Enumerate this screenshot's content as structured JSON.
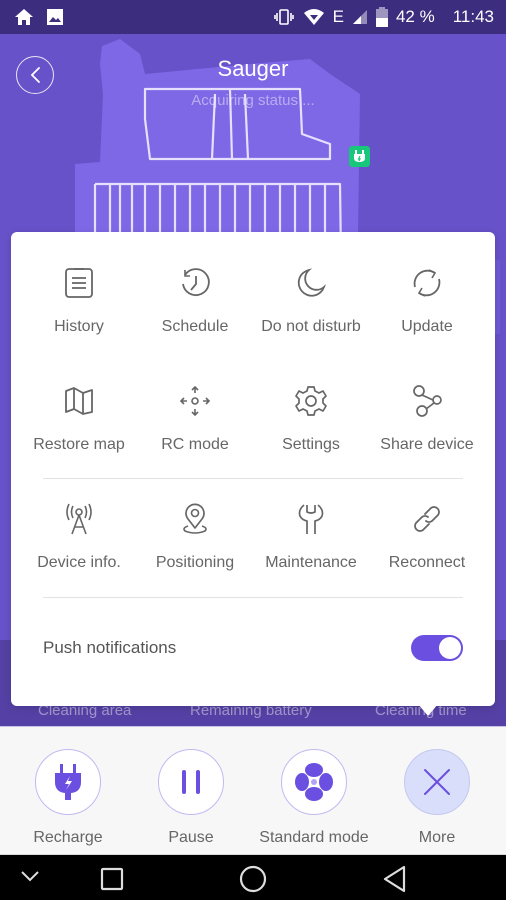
{
  "status_bar": {
    "left_icons": [
      "home-icon",
      "image-icon"
    ],
    "right_icons": [
      "vibrate-icon",
      "wifi-icon",
      "network-e-icon",
      "signal-icon",
      "battery-icon"
    ],
    "network_type": "E",
    "battery": "42 %",
    "time": "11:43"
  },
  "header": {
    "back_icon": "chevron-left-icon",
    "title": "Sauger",
    "subtitle": "Acquiring status ..."
  },
  "map": {
    "dock_icon": "charging-dock-icon",
    "dock_color": "#18c77a"
  },
  "stats": {
    "labels": [
      "Cleaning area",
      "Remaining battery",
      "Cleaning time"
    ]
  },
  "more_menu": {
    "rows": [
      [
        {
          "label": "History",
          "icon": "history-clipboard-icon"
        },
        {
          "label": "Schedule",
          "icon": "schedule-clock-icon"
        },
        {
          "label": "Do not disturb",
          "icon": "moon-icon"
        },
        {
          "label": "Update",
          "icon": "refresh-icon"
        }
      ],
      [
        {
          "label": "Restore map",
          "icon": "map-icon"
        },
        {
          "label": "RC mode",
          "icon": "remote-control-arrows-icon"
        },
        {
          "label": "Settings",
          "icon": "gear-icon"
        },
        {
          "label": "Share device",
          "icon": "share-nodes-icon"
        }
      ],
      [
        {
          "label": "Device info.",
          "icon": "antenna-tower-icon"
        },
        {
          "label": "Positioning",
          "icon": "location-pin-icon"
        },
        {
          "label": "Maintenance",
          "icon": "wrench-icon"
        },
        {
          "label": "Reconnect",
          "icon": "link-icon"
        }
      ]
    ],
    "push_notifications": {
      "label": "Push notifications",
      "enabled": true
    }
  },
  "controls": [
    {
      "label": "Recharge",
      "icon": "plug-charge-icon"
    },
    {
      "label": "Pause",
      "icon": "pause-icon"
    },
    {
      "label": "Standard mode",
      "icon": "fan-icon"
    },
    {
      "label": "More",
      "icon": "close-icon",
      "active": true
    }
  ],
  "nav_bar": {
    "icons": [
      "hide-keyboard-chevron-icon",
      "recents-square-icon",
      "home-circle-icon",
      "back-triangle-icon"
    ]
  },
  "colors": {
    "accent": "#6a4fe0",
    "header_bg": "#6752c9",
    "status_bar_bg": "#3d2d7e",
    "stats_band_bg": "#5541a5"
  }
}
